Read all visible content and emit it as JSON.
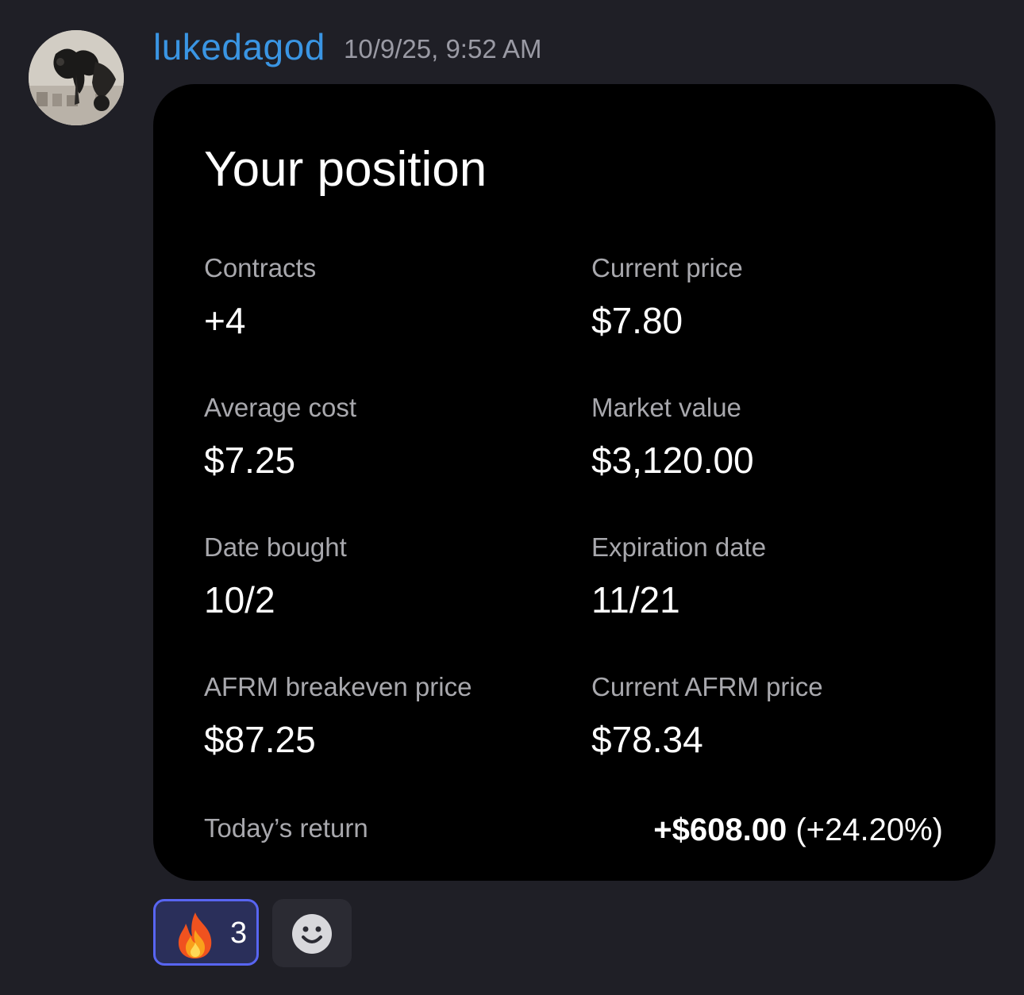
{
  "message": {
    "username": "lukedagod",
    "timestamp": "10/9/25, 9:52 AM",
    "avatar_icon": "statue-avatar",
    "username_color": "#3a95e3"
  },
  "card": {
    "title": "Your position",
    "fields": [
      {
        "label": "Contracts",
        "value": "+4"
      },
      {
        "label": "Current price",
        "value": "$7.80"
      },
      {
        "label": "Average cost",
        "value": "$7.25"
      },
      {
        "label": "Market value",
        "value": "$3,120.00"
      },
      {
        "label": "Date bought",
        "value": "10/2"
      },
      {
        "label": "Expiration date",
        "value": "11/21"
      },
      {
        "label": "AFRM breakeven price",
        "value": "$87.25"
      },
      {
        "label": "Current AFRM price",
        "value": "$78.34"
      }
    ],
    "return": {
      "label": "Today’s return",
      "amount": "+$608.00",
      "percent": "(+24.20%)"
    }
  },
  "reactions": {
    "fire": {
      "emoji": "fire-emoji",
      "count": "3",
      "accent": "#5865f2"
    },
    "add_reaction_icon": "smiley-add-reaction-icon"
  }
}
